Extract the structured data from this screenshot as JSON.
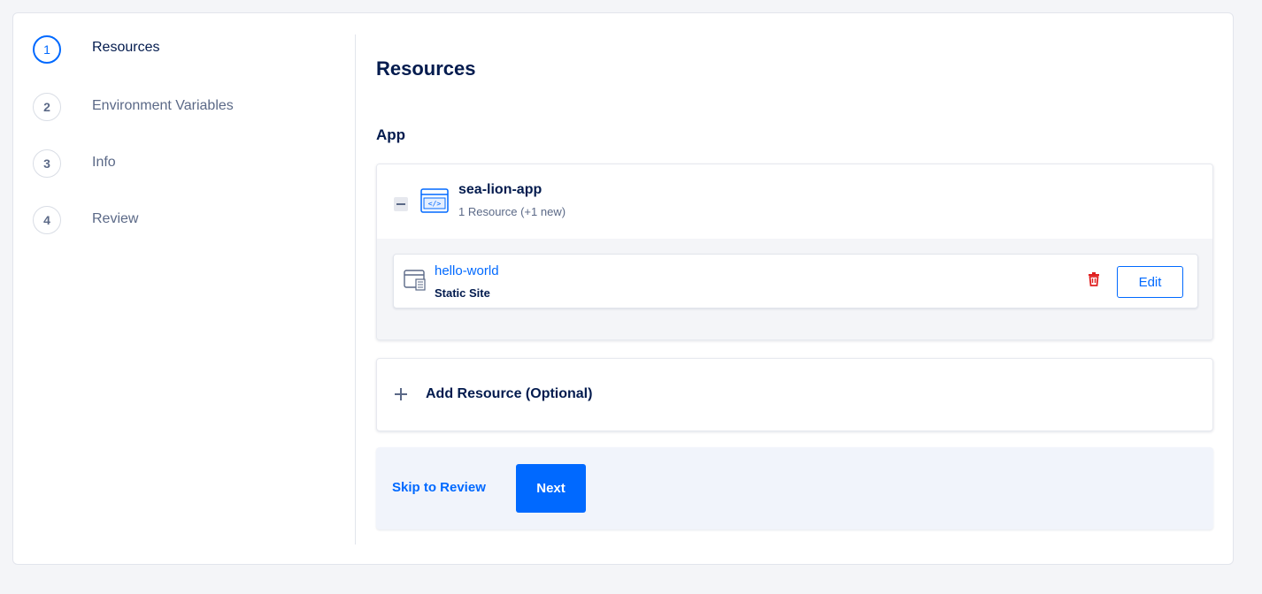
{
  "steps": [
    {
      "number": "1",
      "label": "Resources",
      "active": true
    },
    {
      "number": "2",
      "label": "Environment Variables",
      "active": false
    },
    {
      "number": "3",
      "label": "Info",
      "active": false
    },
    {
      "number": "4",
      "label": "Review",
      "active": false
    }
  ],
  "main": {
    "title": "Resources",
    "section_label": "App"
  },
  "app": {
    "name": "sea-lion-app",
    "meta": "1 Resource (+1 new)",
    "icon": "code-window-icon",
    "collapse_icon": "minus-icon"
  },
  "resources": [
    {
      "name": "hello-world",
      "type": "Static Site",
      "icon": "static-site-icon",
      "delete_icon": "trash-icon",
      "edit_label": "Edit"
    }
  ],
  "add_resource": {
    "label": "Add Resource (Optional)",
    "icon": "plus-icon"
  },
  "footer": {
    "skip_label": "Skip to Review",
    "next_label": "Next"
  },
  "colors": {
    "accent": "#0069ff",
    "text_primary": "#031b4e",
    "text_secondary": "#5b6987",
    "danger": "#e02020",
    "background": "#f4f5f8"
  }
}
